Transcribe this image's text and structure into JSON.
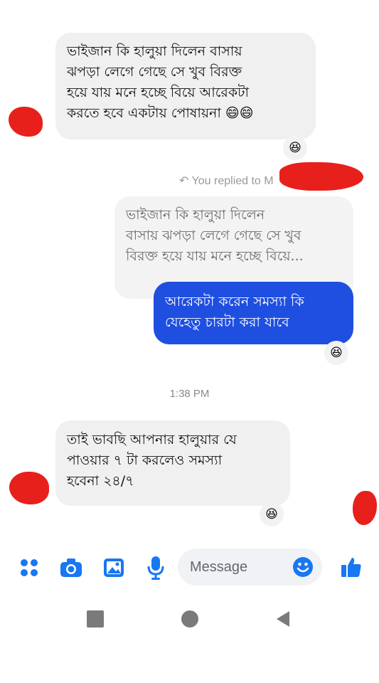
{
  "conversation": {
    "messages": [
      {
        "direction": "incoming",
        "text": "ভাইজান কি হালুয়া দিলেন বাসায়\nঝপড়া লেগে গেছে সে খুব বিরক্ত\nহয়ে যায় মনে হচ্ছে বিয়ে আরেকটা\nকরতে হবে একটায় পোষায়না 😄😄",
        "reaction": "😆"
      },
      {
        "direction": "reply-indicator",
        "text": "You replied to M"
      },
      {
        "direction": "quoted",
        "text": "ভাইজান কি হালুয়া দিলেন\nবাসায় ঝপড়া লেগে গেছে সে খুব\nবিরক্ত হয়ে যায় মনে হচ্ছে বিয়ে..."
      },
      {
        "direction": "outgoing",
        "text": "আরেকটা করেন সমস্যা কি\nযেহেতু চারটা করা যাবে",
        "reaction": "😆"
      },
      {
        "direction": "timestamp",
        "text": "1:38 PM"
      },
      {
        "direction": "incoming",
        "text": "তাই ভাবছি আপনার হালুয়ার যে\nপাওয়ার ৭ টা করলেও সমস্যা\nহবেনা ২৪/৭",
        "reaction": "😆"
      }
    ]
  },
  "composer": {
    "placeholder": "Message",
    "icons": [
      "menu-dots-icon",
      "camera-icon",
      "gallery-icon",
      "microphone-icon",
      "emoji-icon",
      "like-icon"
    ]
  },
  "colors": {
    "outgoing_bubble": "#1f4fe0",
    "incoming_bubble": "#f0f0f0",
    "accent": "#1877f2",
    "redaction": "#e8201c"
  },
  "navigation": {
    "icons": [
      "recent-apps-icon",
      "home-icon",
      "back-icon"
    ]
  }
}
